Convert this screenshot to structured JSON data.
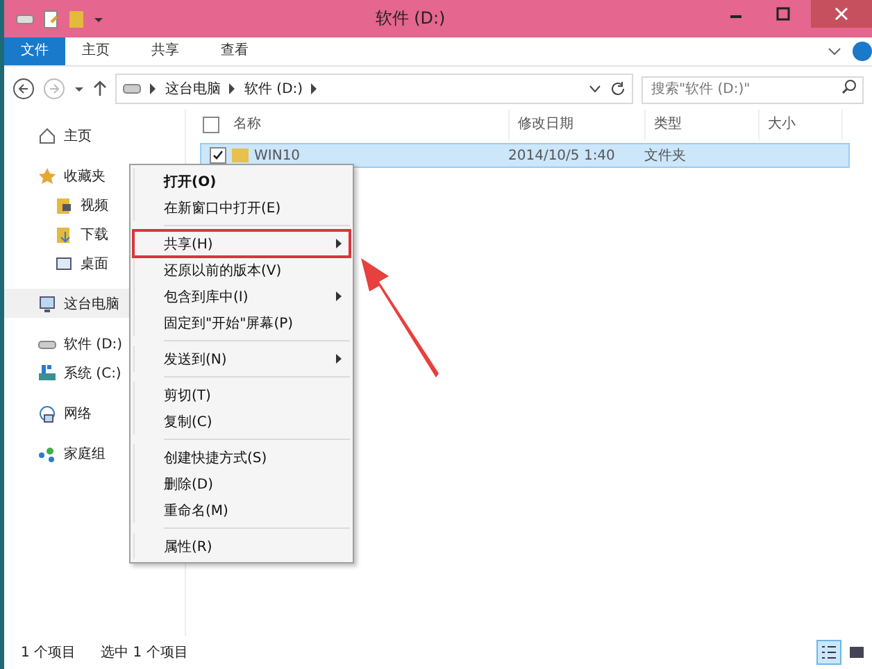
{
  "window": {
    "title": "软件 (D:)"
  },
  "ribbon_tabs": [
    {
      "label": "文件",
      "kind": "file"
    },
    {
      "label": "主页",
      "kind": "tab"
    },
    {
      "label": "共享",
      "kind": "tab"
    },
    {
      "label": "查看",
      "kind": "tab"
    }
  ],
  "breadcrumb": [
    "这台电脑",
    "软件 (D:)"
  ],
  "search": {
    "placeholder": "搜索\"软件 (D:)\""
  },
  "sidebar": {
    "groups": [
      {
        "items": [
          {
            "label": "主页",
            "selected": false
          }
        ]
      },
      {
        "items": [
          {
            "label": "收藏夹",
            "selected": false,
            "children": [
              {
                "label": "视频",
                "selected": false
              },
              {
                "label": "下载",
                "selected": false
              },
              {
                "label": "桌面",
                "selected": false
              }
            ]
          }
        ]
      },
      {
        "items": [
          {
            "label": "这台电脑",
            "selected": true
          }
        ]
      },
      {
        "items": [
          {
            "label": "软件 (D:)",
            "selected": false
          },
          {
            "label": "系统 (C:)",
            "selected": false
          }
        ]
      },
      {
        "items": [
          {
            "label": "网络",
            "selected": false
          }
        ]
      },
      {
        "items": [
          {
            "label": "家庭组",
            "selected": false
          }
        ]
      }
    ]
  },
  "table": {
    "select_all_checked": false,
    "columns": [
      "名称",
      "修改日期",
      "类型",
      "大小"
    ],
    "rows": [
      {
        "name": "WIN10",
        "modified": "2014/10/5 1:40",
        "type": "文件夹",
        "size": "",
        "selected": true,
        "checked": true
      }
    ]
  },
  "context_menu": [
    {
      "kind": "item",
      "label": "打开(O)",
      "bold": true,
      "submenu": false,
      "annotated": false
    },
    {
      "kind": "item",
      "label": "在新窗口中打开(E)",
      "bold": false,
      "submenu": false,
      "annotated": false
    },
    {
      "kind": "separator"
    },
    {
      "kind": "item",
      "label": "共享(H)",
      "bold": false,
      "submenu": true,
      "annotated": true
    },
    {
      "kind": "item",
      "label": "还原以前的版本(V)",
      "bold": false,
      "submenu": false,
      "annotated": false
    },
    {
      "kind": "item",
      "label": "包含到库中(I)",
      "bold": false,
      "submenu": true,
      "annotated": false
    },
    {
      "kind": "item",
      "label": "固定到\"开始\"屏幕(P)",
      "bold": false,
      "submenu": false,
      "annotated": false
    },
    {
      "kind": "separator"
    },
    {
      "kind": "item",
      "label": "发送到(N)",
      "bold": false,
      "submenu": true,
      "annotated": false
    },
    {
      "kind": "separator"
    },
    {
      "kind": "item",
      "label": "剪切(T)",
      "bold": false,
      "submenu": false,
      "annotated": false
    },
    {
      "kind": "item",
      "label": "复制(C)",
      "bold": false,
      "submenu": false,
      "annotated": false
    },
    {
      "kind": "separator"
    },
    {
      "kind": "item",
      "label": "创建快捷方式(S)",
      "bold": false,
      "submenu": false,
      "annotated": false
    },
    {
      "kind": "item",
      "label": "删除(D)",
      "bold": false,
      "submenu": false,
      "annotated": false
    },
    {
      "kind": "item",
      "label": "重命名(M)",
      "bold": false,
      "submenu": false,
      "annotated": false
    },
    {
      "kind": "separator"
    },
    {
      "kind": "item",
      "label": "属性(R)",
      "bold": false,
      "submenu": false,
      "annotated": false
    }
  ],
  "status_bar": {
    "count": "1 个项目",
    "selection": "选中 1 个项目",
    "view_buttons": [
      {
        "selected": true
      },
      {
        "selected": false
      }
    ]
  }
}
